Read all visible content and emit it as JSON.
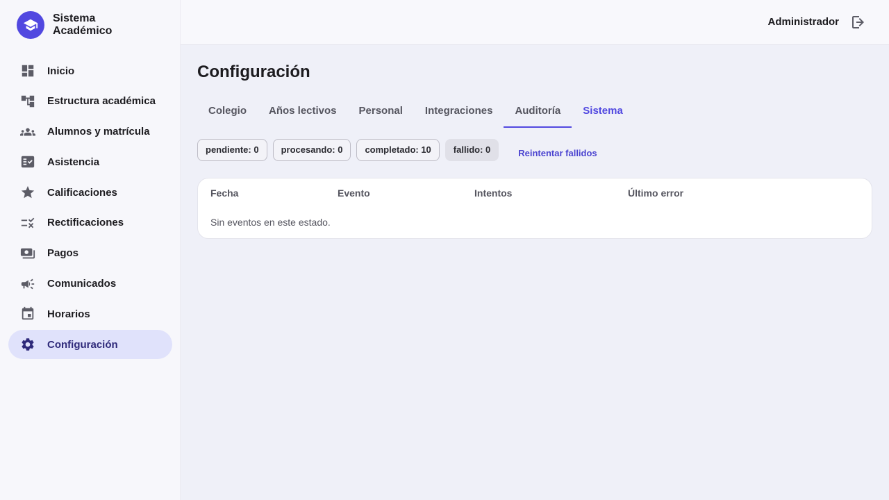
{
  "brand": {
    "line1": "Sistema",
    "line2": "Académico",
    "logo_icon": "graduation-cap-icon",
    "color": "#5148e0"
  },
  "sidebar": {
    "items": [
      {
        "label": "Inicio",
        "icon": "dashboard-icon",
        "active": false
      },
      {
        "label": "Estructura académica",
        "icon": "account-tree-icon",
        "active": false
      },
      {
        "label": "Alumnos y matrícula",
        "icon": "groups-icon",
        "active": false
      },
      {
        "label": "Asistencia",
        "icon": "fact-check-icon",
        "active": false
      },
      {
        "label": "Calificaciones",
        "icon": "star-icon",
        "active": false
      },
      {
        "label": "Rectificaciones",
        "icon": "rule-icon",
        "active": false
      },
      {
        "label": "Pagos",
        "icon": "payments-icon",
        "active": false
      },
      {
        "label": "Comunicados",
        "icon": "campaign-icon",
        "active": false
      },
      {
        "label": "Horarios",
        "icon": "calendar-icon",
        "active": false
      },
      {
        "label": "Configuración",
        "icon": "gear-icon",
        "active": true
      }
    ]
  },
  "header": {
    "user": "Administrador",
    "logout_icon": "logout-icon"
  },
  "main": {
    "title": "Configuración",
    "tabs": [
      {
        "label": "Colegio"
      },
      {
        "label": "Años lectivos"
      },
      {
        "label": "Personal"
      },
      {
        "label": "Integraciones"
      },
      {
        "label": "Auditoría"
      },
      {
        "label": "Sistema"
      }
    ],
    "underlined_tab": "Auditoría",
    "current_tab": "Sistema",
    "status_chips": [
      {
        "label": "pendiente: 0",
        "selected": false
      },
      {
        "label": "procesando: 0",
        "selected": false
      },
      {
        "label": "completado: 10",
        "selected": false
      },
      {
        "label": "fallido: 0",
        "selected": true
      }
    ],
    "retry_label": "Reintentar fallidos",
    "table": {
      "columns": [
        "Fecha",
        "Evento",
        "Intentos",
        "Último error"
      ],
      "empty_text": "Sin eventos en este estado."
    }
  }
}
